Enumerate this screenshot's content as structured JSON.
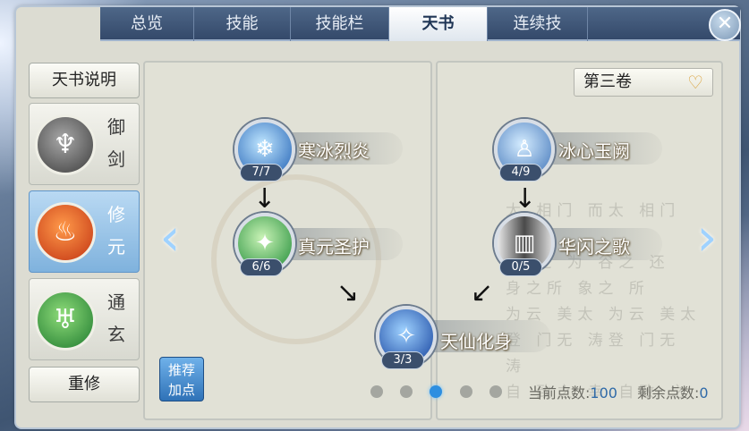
{
  "tabs": [
    "总览",
    "技能",
    "技能栏",
    "天书",
    "连续技"
  ],
  "active_tab": "天书",
  "close_label": "✕",
  "left_panel": {
    "info_button": "天书说明",
    "categories": [
      {
        "label_1": "御",
        "label_2": "剑",
        "icon": "sword-spirit-icon",
        "color": "#5f5f5f"
      },
      {
        "label_1": "修",
        "label_2": "元",
        "icon": "flame-spirit-icon",
        "color": "#d84a1e",
        "active": true
      },
      {
        "label_1": "通",
        "label_2": "玄",
        "icon": "jade-spirit-icon",
        "color": "#2b8a3a"
      }
    ],
    "reset_button": "重修"
  },
  "recommend_button": {
    "line1": "推荐",
    "line2": "加点"
  },
  "volume": {
    "selected": "第三卷"
  },
  "skills": [
    {
      "name": "寒冰烈炎",
      "level": "7/7",
      "icon": "ice-crystal-icon",
      "color": "#2f7fd6"
    },
    {
      "name": "真元圣护",
      "level": "6/6",
      "icon": "green-sparkle-icon",
      "color": "#2fa84a"
    },
    {
      "name": "天仙化身",
      "level": "3/3",
      "icon": "blue-spirit-icon",
      "color": "#2a5fc4"
    },
    {
      "name": "冰心玉阙",
      "level": "4/9",
      "icon": "meditating-figure-icon",
      "color": "#5b8fcf"
    },
    {
      "name": "华闪之歌",
      "level": "0/5",
      "icon": "silver-veil-icon",
      "color": "#7a7a7a"
    }
  ],
  "poem_lines": [
    "太 相门 而太 相门 而",
    "谷 之 为 谷之 还",
    "身之所 象之 所",
    "为云 美太 为云 美太",
    "登 门无 涛登 门无 涛",
    "自 致之 幸 自致 之"
  ],
  "page_dots": 5,
  "active_dot": 3,
  "points": {
    "current_label": "当前点数:",
    "current_value": "100",
    "remaining_label": "剩余点数:",
    "remaining_value": "0"
  }
}
